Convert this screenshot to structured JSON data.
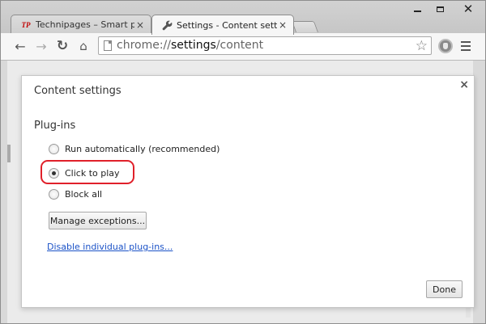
{
  "tabs": [
    {
      "favicon_text": "TP",
      "title": "Technipages – Smart phor",
      "close": "×",
      "active": false
    },
    {
      "title": "Settings - Content setting",
      "close": "×",
      "active": true
    }
  ],
  "window_controls": {
    "close": "✕"
  },
  "toolbar": {
    "back": "←",
    "forward": "→",
    "reload": "↻",
    "home": "⌂",
    "star": "☆"
  },
  "omnibox": {
    "scheme": "chrome://",
    "host": "settings",
    "path": "/content"
  },
  "icons": {
    "tab_settings": "wrench-icon",
    "extension": "shield-icon",
    "menu": "hamburger-menu-icon"
  },
  "dialog": {
    "title": "Content settings",
    "close": "×",
    "section_title": "Plug-ins",
    "options": [
      {
        "label": "Run automatically (recommended)",
        "checked": false
      },
      {
        "label": "Click to play",
        "checked": true
      },
      {
        "label": "Block all",
        "checked": false
      }
    ],
    "manage_button": "Manage exceptions...",
    "link": "Disable individual plug-ins...",
    "done_button": "Done"
  },
  "colors": {
    "highlight": "#e0202a",
    "link": "#1b52c7"
  }
}
